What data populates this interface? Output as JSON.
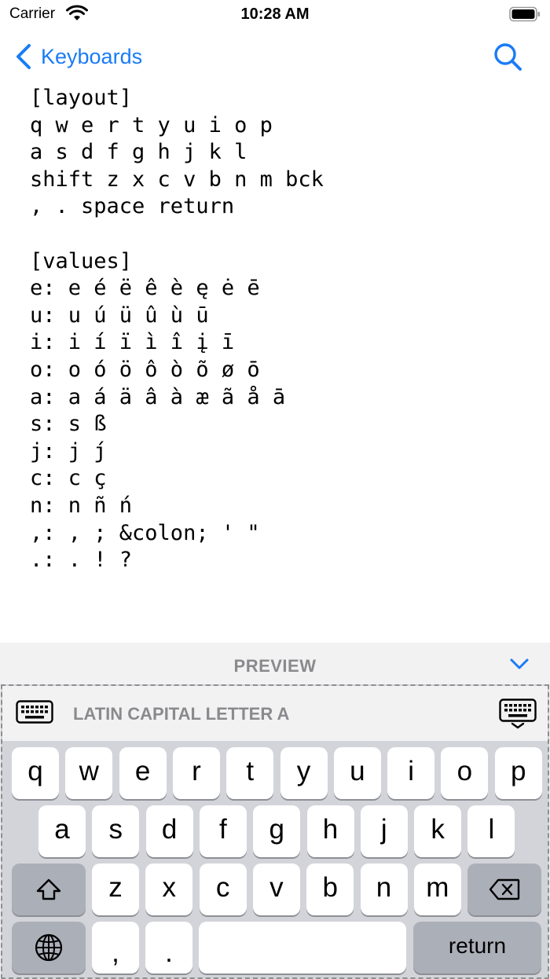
{
  "status_bar": {
    "carrier": "Carrier",
    "time": "10:28 AM"
  },
  "nav": {
    "back_label": "Keyboards"
  },
  "editor": {
    "lines": [
      "[layout]",
      "q w e r t y u i o p",
      "a s d f g h j k l",
      "shift z x c v b n m bck",
      ", . space return",
      "",
      "[values]",
      "e: e é ë ê è ę ė ē",
      "u: u ú ü û ù ū",
      "i: i í ï ì î į ī",
      "o: o ó ö ô ò õ ø ō",
      "a: a á ä â à æ ã å ā",
      "s: s ß",
      "j: j ȷ́",
      "c: c ç",
      "n: n ñ ń",
      ",: , ; &colon; ' \"",
      ".: . ! ?"
    ]
  },
  "preview": {
    "title": "PREVIEW",
    "character_name": "LATIN CAPITAL LETTER A"
  },
  "keyboard": {
    "row1": [
      "q",
      "w",
      "e",
      "r",
      "t",
      "y",
      "u",
      "i",
      "o",
      "p"
    ],
    "row2": [
      "a",
      "s",
      "d",
      "f",
      "g",
      "h",
      "j",
      "k",
      "l"
    ],
    "row3": [
      "z",
      "x",
      "c",
      "v",
      "b",
      "n",
      "m"
    ],
    "comma": ",",
    "period": ".",
    "return_label": "return"
  },
  "colors": {
    "accent": "#1a7cf5",
    "keyboard_bg": "#d2d4d9",
    "special_key": "#abafb8"
  }
}
